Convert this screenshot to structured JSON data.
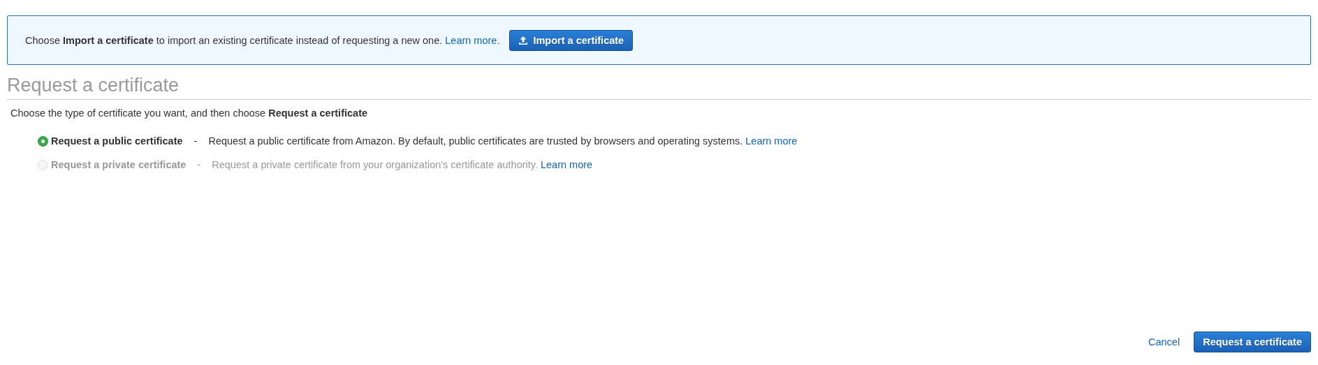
{
  "banner": {
    "message": "Choose **Import a certificate** to import an existing certificate instead of requesting a new one.",
    "link": "Learn more.",
    "button": "Import a certificate"
  },
  "heading": "Request a certificate",
  "intro": "Choose the type of certificate you want, and then choose **Request a certificate**",
  "options": [
    {
      "label": "Request a public certificate",
      "separator": "-",
      "description": "Request a public certificate from Amazon. By default, public certificates are trusted by browsers and operating systems.",
      "link": "Learn more",
      "selected": true,
      "disabled": false
    },
    {
      "label": "Request a private certificate",
      "separator": "-",
      "description": "Request a private certificate from your organization's certificate authority.",
      "link": "Learn more",
      "selected": false,
      "disabled": true
    }
  ],
  "footer": {
    "cancel": "Cancel",
    "submit": "Request a certificate"
  }
}
